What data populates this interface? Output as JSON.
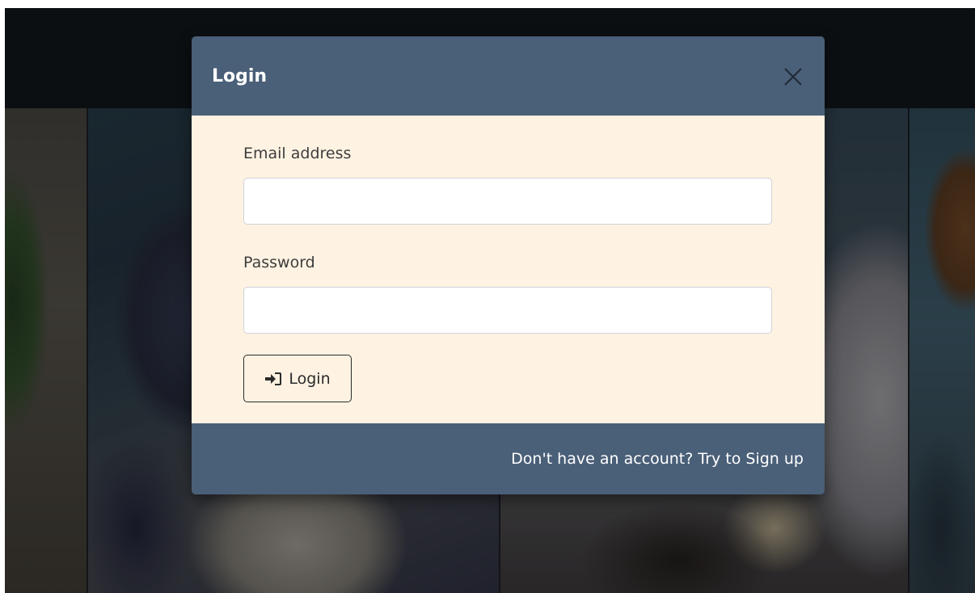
{
  "login_modal": {
    "title": "Login",
    "close_icon": "close-icon",
    "email": {
      "label": "Email address",
      "value": "",
      "placeholder": ""
    },
    "password": {
      "label": "Password",
      "value": "",
      "placeholder": ""
    },
    "submit": {
      "icon": "sign-in-icon",
      "label": "Login"
    },
    "footer_link": "Don't have an account? Try to Sign up"
  },
  "colors": {
    "header_footer_bg": "#4a5f78",
    "body_bg": "#fef2e2",
    "navbar_bg": "#171c21"
  }
}
